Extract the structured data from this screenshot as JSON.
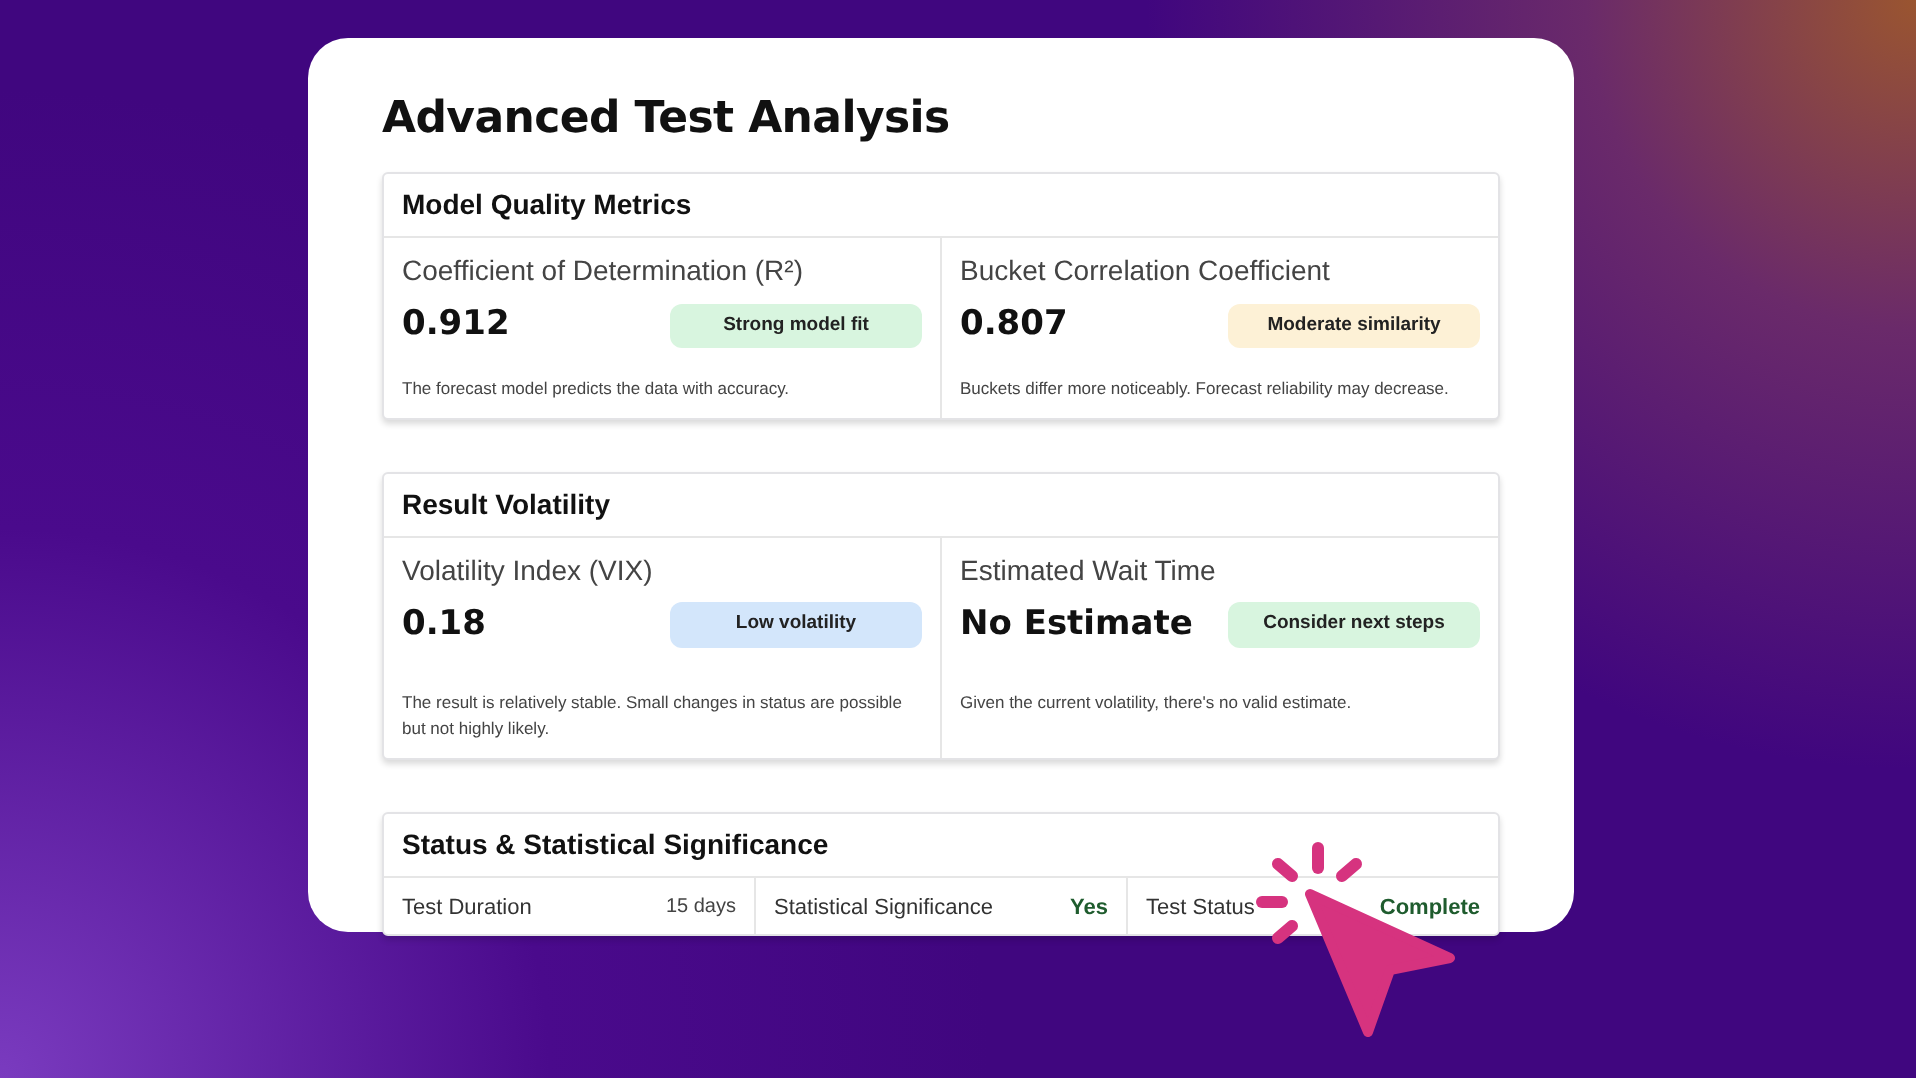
{
  "title": "Advanced Test Analysis",
  "sections": [
    {
      "title": "Model Quality Metrics",
      "metrics": [
        {
          "label": "Coefficient of Determination (R²)",
          "value": "0.912",
          "badge": "Strong model fit",
          "color": "#d8f5df",
          "note": "The forecast model predicts the data with accuracy."
        },
        {
          "label": "Bucket Correlation Coefficient",
          "value": "0.807",
          "badge": "Moderate similarity",
          "color": "#fdf1d6",
          "note": "Buckets differ more noticeably. Forecast reliability may decrease."
        }
      ]
    },
    {
      "title": "Result Volatility",
      "metrics": [
        {
          "label": "Volatility Index (VIX)",
          "value": "0.18",
          "badge": "Low volatility",
          "color": "#d3e6fb",
          "note": "The result is relatively stable. Small changes in status are possible but not highly likely."
        },
        {
          "label": "Estimated Wait Time",
          "value": "No Estimate",
          "badge": "Consider next steps",
          "color": "#d8f5df",
          "note": "Given the current volatility, there's no valid estimate."
        }
      ]
    }
  ],
  "status": {
    "title": "Status & Statistical Significance",
    "items": [
      {
        "label": "Test Duration",
        "value": "15 days",
        "kind": "plain"
      },
      {
        "label": "Statistical Significance",
        "value": "Yes",
        "kind": "positive"
      },
      {
        "label": "Test Status",
        "value": "Complete",
        "kind": "positive"
      }
    ]
  }
}
